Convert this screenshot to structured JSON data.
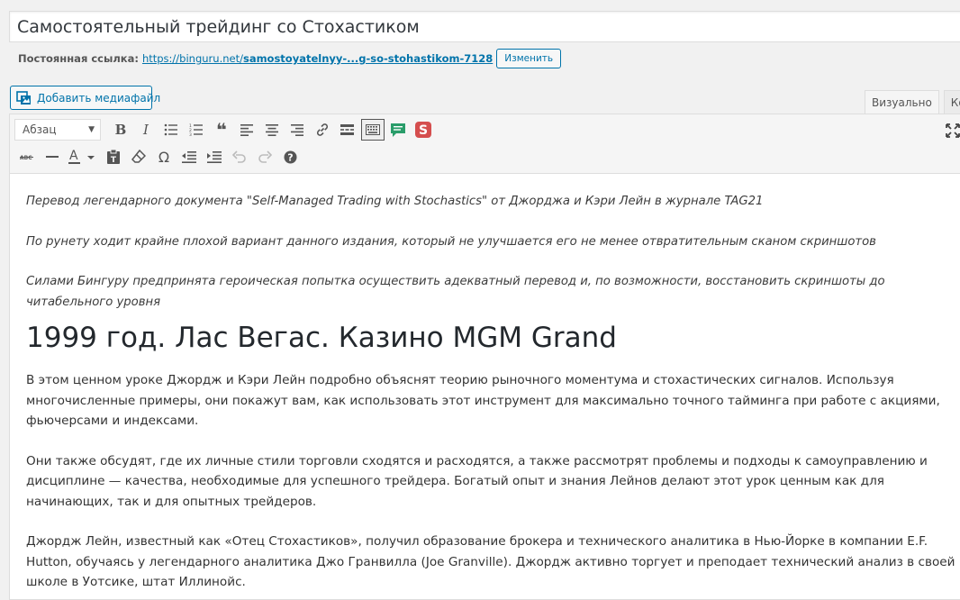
{
  "post": {
    "title": "Самостоятельный трейдинг со Стохастиком"
  },
  "permalink": {
    "label": "Постоянная ссылка:",
    "url_prefix": "https://binguru.net/",
    "url_slug": "samostoyatelnyy-...g-so-stohastikom-7128",
    "edit_label": "Изменить"
  },
  "media": {
    "add_label": "Добавить медиафайл"
  },
  "tabs": [
    {
      "label": "Визуально",
      "active": true
    },
    {
      "label": "Код",
      "active": false
    }
  ],
  "toolbar": {
    "format_select": "Абзац",
    "row1_icons": [
      "bold-icon",
      "italic-icon",
      "bullet-list-icon",
      "numbered-list-icon",
      "blockquote-icon",
      "align-left-icon",
      "align-center-icon",
      "align-right-icon",
      "link-icon",
      "read-more-icon",
      "toolbar-toggle-icon",
      "comment-icon",
      "s-plugin-icon"
    ],
    "row2_icons": [
      "strikethrough-icon",
      "horizontal-line-icon",
      "text-color-icon",
      "paste-text-icon",
      "clear-formatting-icon",
      "special-character-icon",
      "outdent-icon",
      "indent-icon",
      "undo-icon",
      "redo-icon",
      "help-icon"
    ],
    "colors": {
      "accent": "#0073aa",
      "comment": "#2a9d6a",
      "plugin": "#d54e4e"
    }
  },
  "content": {
    "intro": [
      "Перевод легендарного документа \"Self-Managed Trading with Stochastics\" от Джорджа и Кэри Лейн в журнале TAG21",
      "По рунету ходит крайне плохой вариант данного издания, который не улучшается его не менее отвратительным сканом скриншотов",
      "Силами Бингуру предпринята героическая попытка осуществить адекватный перевод и, по возможности, восстановить скриншоты до читабельного уровня"
    ],
    "heading": "1999 год. Лас Вегас. Казино MGM Grand",
    "paragraphs": [
      "В этом ценном уроке Джордж и Кэри Лейн подробно объяснят теорию рыночного моментума и стохастических сигналов. Используя многочисленные примеры, они покажут вам, как использовать этот инструмент для максимально точного тайминга при работе с акциями, фьючерсами и индексами.",
      "Они также обсудят, где их личные стили торговли сходятся и расходятся, а также рассмотрят проблемы и подходы к самоуправлению и дисциплине — качества, необходимые для успешного трейдера. Богатый опыт и знания Лейнов делают этот урок ценным как для начинающих, так и для опытных трейдеров.",
      "Джордж Лейн, известный как «Отец Стохастиков», получил образование брокера и технического аналитика в Нью-Йорке в компании E.F. Hutton, обучаясь у легендарного аналитика Джо Гранвилла (Joe Granville). Джордж активно торгует и преподает технический анализ в своей школе в Уотсике, штат Иллинойс."
    ]
  }
}
